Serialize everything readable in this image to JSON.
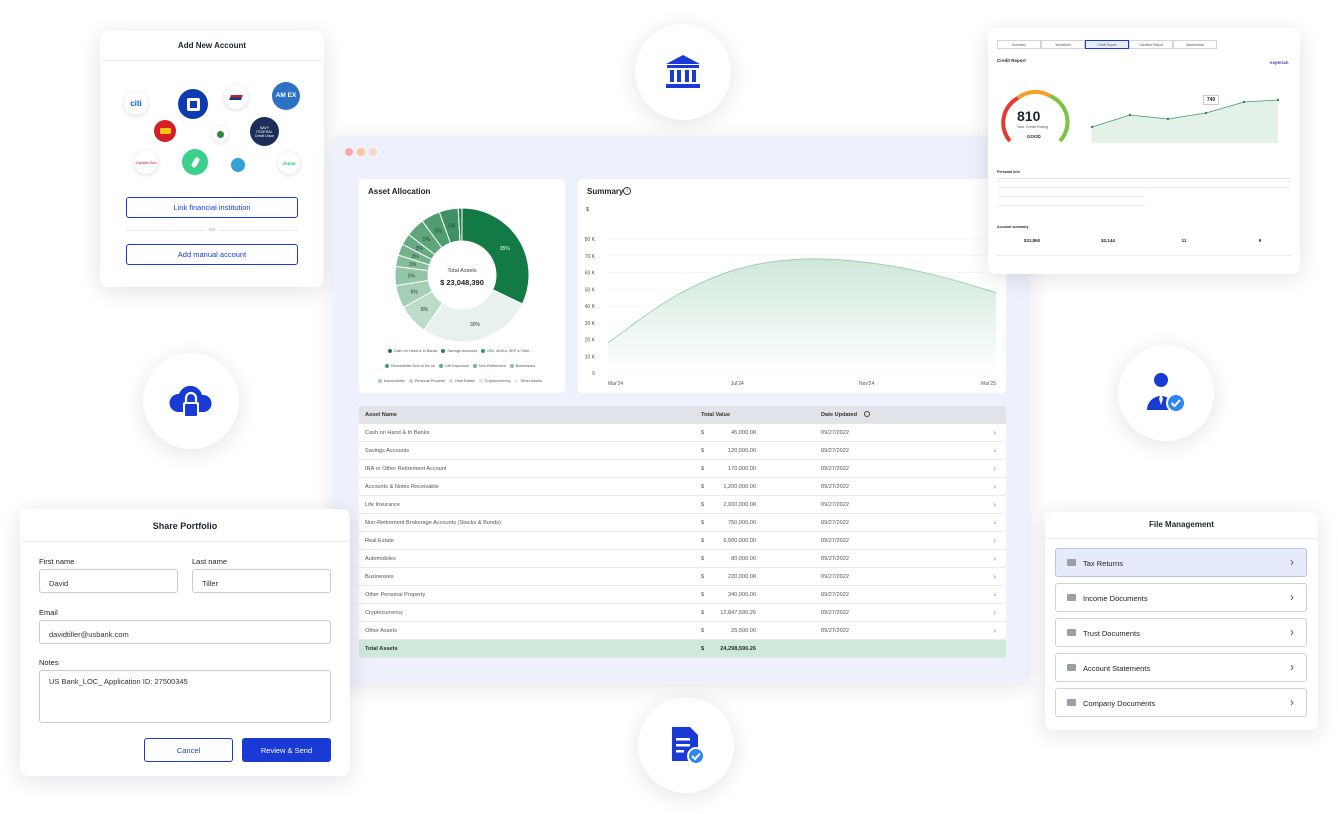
{
  "add_account": {
    "title": "Add New Account",
    "link_button": "Link financial institution",
    "or_text": "OR",
    "manual_button": "Add manual account",
    "logos": [
      "citi",
      "AM EX",
      "NAVY FEDERAL Credit Union",
      "Capital One",
      "chime"
    ]
  },
  "main": {
    "asset_allocation": {
      "title": "Asset Allocation",
      "center_label": "Total Assets",
      "center_value": "$ 23,048,390",
      "slice_labels": [
        "35%",
        "30%",
        "8%",
        "6%",
        "5%",
        "3%",
        "3%",
        "3%",
        "5%",
        "5%",
        "5%"
      ],
      "legend": [
        "Cash on Hand & In Banks",
        "Savings Accounts",
        "IRA, 401Ks, SEP & Othe...",
        "Receivables Due to No on",
        "Life Insurance",
        "Non-Retirement",
        "Businesses",
        "Automobiles",
        "Personal Property",
        "Real Estate",
        "Cryptocurrency",
        "Other Assets"
      ]
    },
    "summary": {
      "title": "Summary",
      "info_icon": "info-icon",
      "y_unit": "$"
    },
    "table": {
      "headers": [
        "Asset Name",
        "Total Value",
        "Date Updated"
      ],
      "currency": "$",
      "rows": [
        {
          "name": "Cash on Hand & In Banks",
          "value": "45,000.00",
          "date": "09/27/2022"
        },
        {
          "name": "Savings Accounts",
          "value": "120,500.00",
          "date": "09/27/2022"
        },
        {
          "name": "IRA or Other Retirement Account",
          "value": "170,000.00",
          "date": "09/27/2022"
        },
        {
          "name": "Accounts & Notes Receivable",
          "value": "1,200,000.00",
          "date": "09/27/2022"
        },
        {
          "name": "Life Insurance",
          "value": "2,000,000.00",
          "date": "09/27/2022"
        },
        {
          "name": "Non-Retirement Brokerage Accounts (Stocks & Bonds)",
          "value": "750,000.00",
          "date": "09/27/2022"
        },
        {
          "name": "Real Estate",
          "value": "6,500,000.00",
          "date": "09/27/2022"
        },
        {
          "name": "Automobiles",
          "value": "80,000.00",
          "date": "09/27/2022"
        },
        {
          "name": "Businesses",
          "value": "220,000.00",
          "date": "09/27/2022"
        },
        {
          "name": "Other Personal Property",
          "value": "340,000.00",
          "date": "09/27/2022"
        },
        {
          "name": "Cryptocurrency",
          "value": "12,847,590.26",
          "date": "09/27/2022"
        },
        {
          "name": "Other Assets",
          "value": "25,500.00",
          "date": "09/27/2022"
        }
      ],
      "total_label": "Total Assets",
      "total_value": "24,298,590.26"
    }
  },
  "share_portfolio": {
    "title": "Share Portfolio",
    "first_name_label": "First name",
    "first_name_value": "David",
    "last_name_label": "Last name",
    "last_name_value": "Tiller",
    "email_label": "Email",
    "email_value": "davidtiller@usbank.com",
    "notes_label": "Notes",
    "notes_value": "US Bank_LOC_ Application ID: 27500345",
    "cancel_button": "Cancel",
    "send_button": "Review & Send"
  },
  "file_management": {
    "title": "File Management",
    "items": [
      "Tax Returns",
      "Income Documents",
      "Trust Documents",
      "Account Statements",
      "Company Documents"
    ]
  },
  "credit_report": {
    "tabs": [
      "Summary",
      "Worksheet",
      "Credit Report",
      "Cashflow Report",
      "Attachments"
    ],
    "title": "Credit Report",
    "bureau": "experian",
    "score": "810",
    "score_label": "Your Credit Rating",
    "rating": "GOOD",
    "tooltip_value": "740",
    "personal_info_title": "Personal Info",
    "account_summary_title": "Account summary",
    "stats": [
      "$31,860",
      "$2,144",
      "11",
      "9"
    ]
  },
  "colors": {
    "brand_blue": "#1a3ad6",
    "dark_green": "#137a45",
    "mid_green": "#4fa878",
    "light_green": "#b9ddc8",
    "total_row": "#cfe8dc"
  },
  "chart_data": [
    {
      "type": "pie",
      "title": "Asset Allocation",
      "categories": [
        "Cash on Hand & In Banks",
        "Savings Accounts",
        "IRA, 401Ks, SEP & Othe...",
        "Receivables Due to No on",
        "Life Insurance",
        "Non-Retirement",
        "Businesses",
        "Automobiles",
        "Personal Property",
        "Real Estate",
        "Cryptocurrency",
        "Other Assets"
      ],
      "values": [
        35,
        30,
        8,
        6,
        5,
        3,
        3,
        3,
        5,
        5,
        5,
        1
      ]
    },
    {
      "type": "area",
      "title": "Summary",
      "x": [
        "Mar'24",
        "Jul'24",
        "Nov'24",
        "Mar'25"
      ],
      "y_ticks": [
        "0",
        "10 K",
        "20 K",
        "30 K",
        "40 K",
        "50 K",
        "60 K",
        "70 K",
        "80 K"
      ],
      "ylabel": "$",
      "ylim": [
        0,
        80000
      ],
      "series": [
        {
          "values": [
            18000,
            45000,
            62000,
            68000,
            66000,
            59000,
            48000
          ]
        }
      ]
    }
  ]
}
